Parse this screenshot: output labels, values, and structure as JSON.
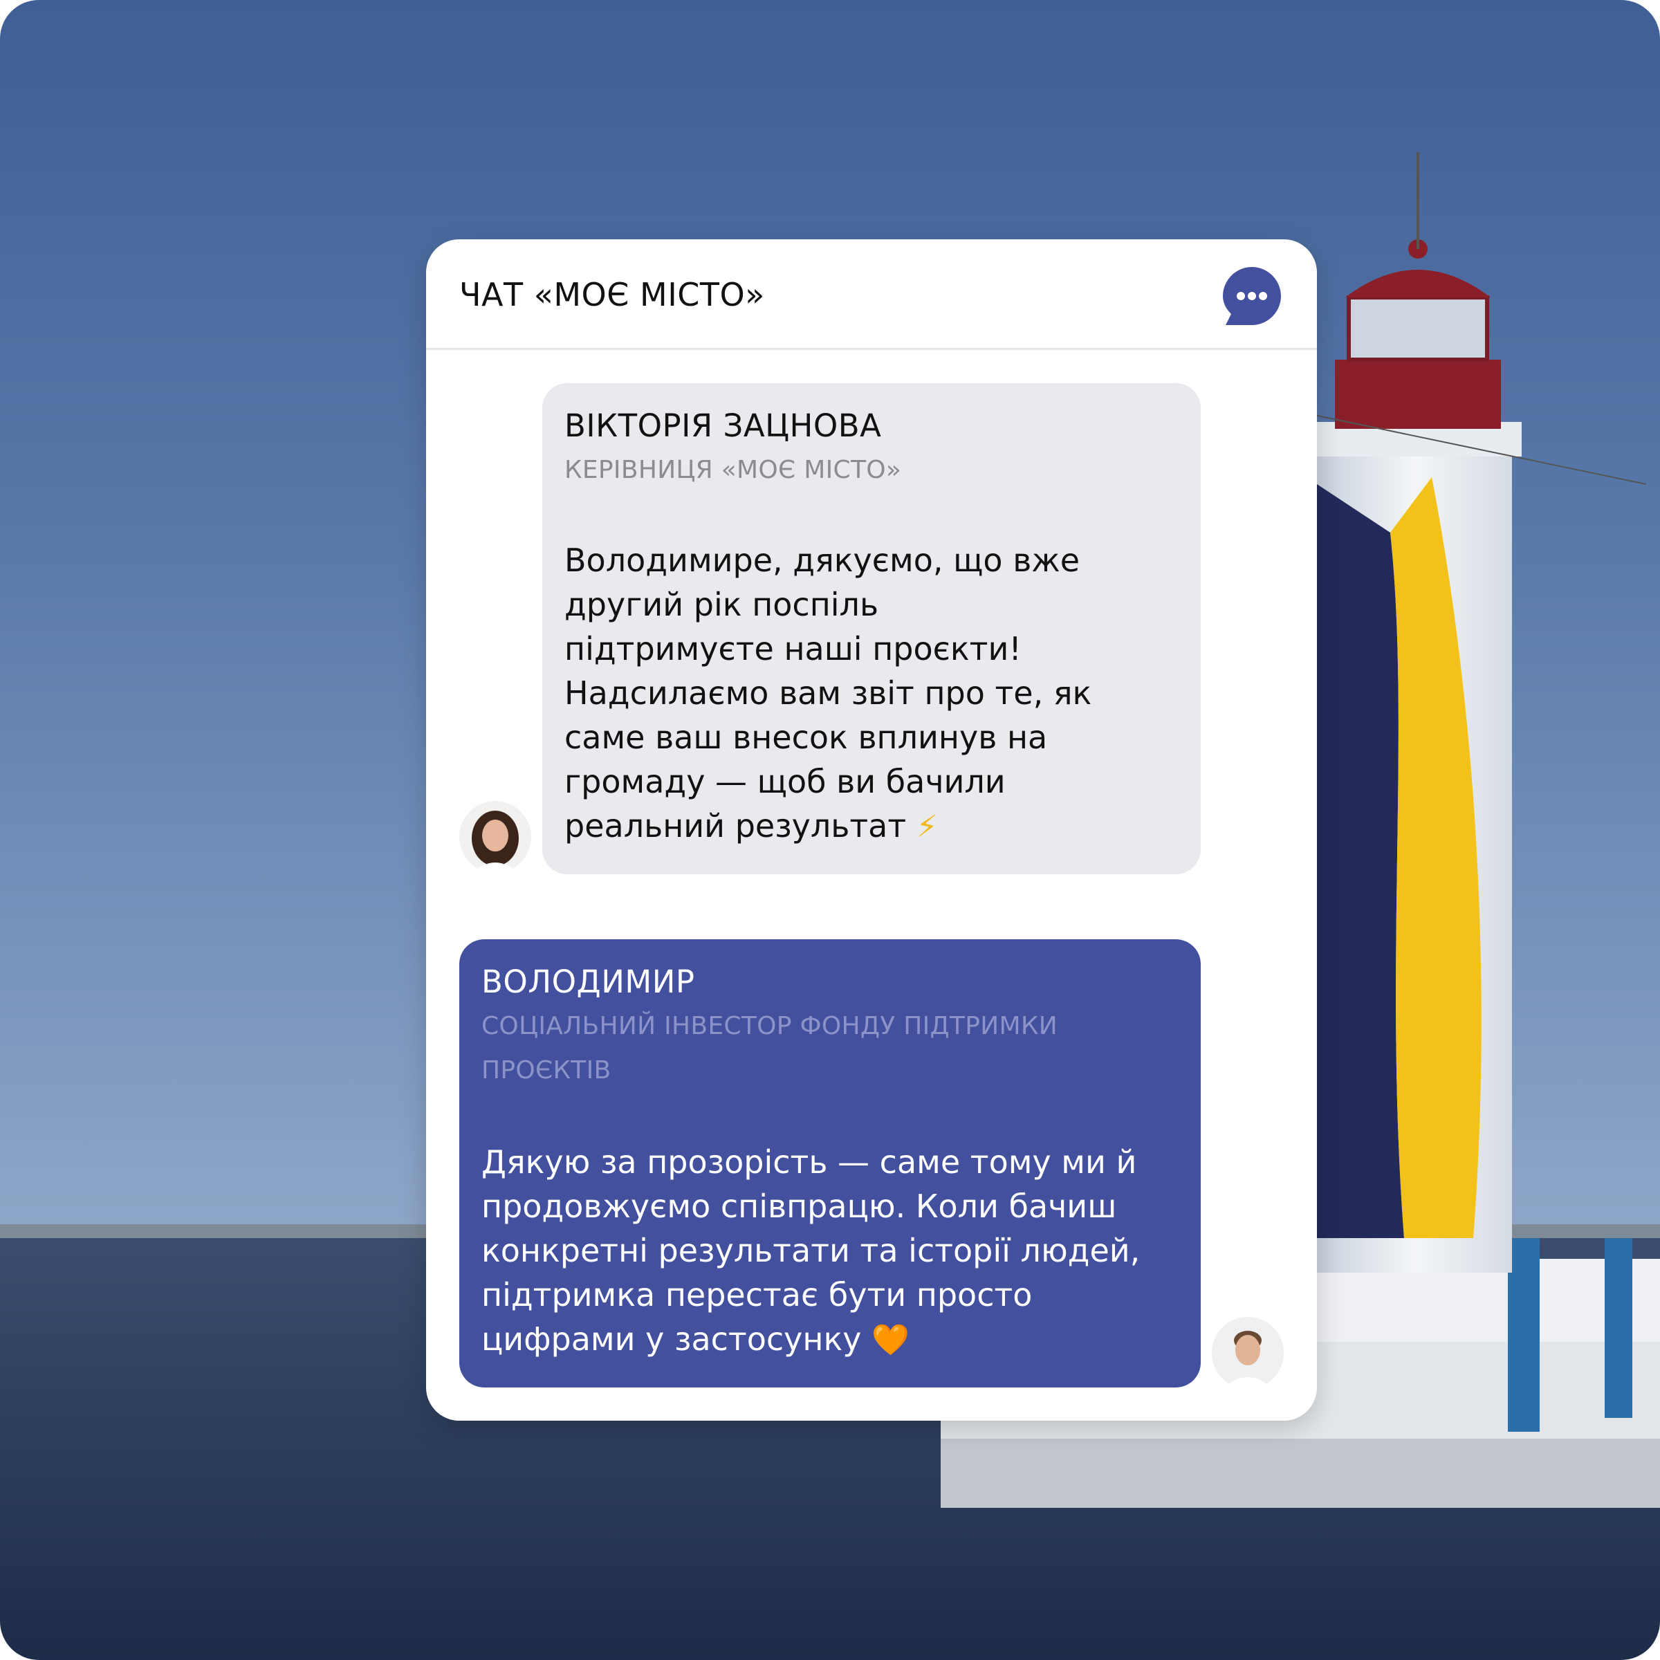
{
  "chat": {
    "title": "ЧАТ «МОЄ МІСТО»",
    "menu_icon": "more-dots-chat-icon",
    "accent_color": "#43509e"
  },
  "messages": [
    {
      "sender": "ВІКТОРІЯ ЗАЦНОВА",
      "role": "КЕРІВНИЦЯ «МОЄ МІСТО»",
      "text": "Володимире, дякуємо, що вже\nдругий рік поспіль\nпідтримуєте наші проєкти!\nНадсилаємо вам звіт про те, як\nсаме ваш внесок вплинув на\nгромаду — щоб ви бачили\nреальний результат ",
      "emoji": "⚡",
      "bubble_color": "#e9eaee"
    },
    {
      "sender": "ВОЛОДИМИР",
      "role": "СОЦІАЛЬНИЙ ІНВЕСТОР ФОНДУ ПІДТРИМКИ ПРОЄКТІВ",
      "text": "Дякую за прозорість — саме тому ми й\nпродовжуємо співпрацю. Коли бачиш\nконкретні результати та історії людей,\nпідтримка перестає бути просто\nцифрами у застосунку ",
      "emoji": "🧡",
      "bubble_color": "#43509e"
    }
  ]
}
